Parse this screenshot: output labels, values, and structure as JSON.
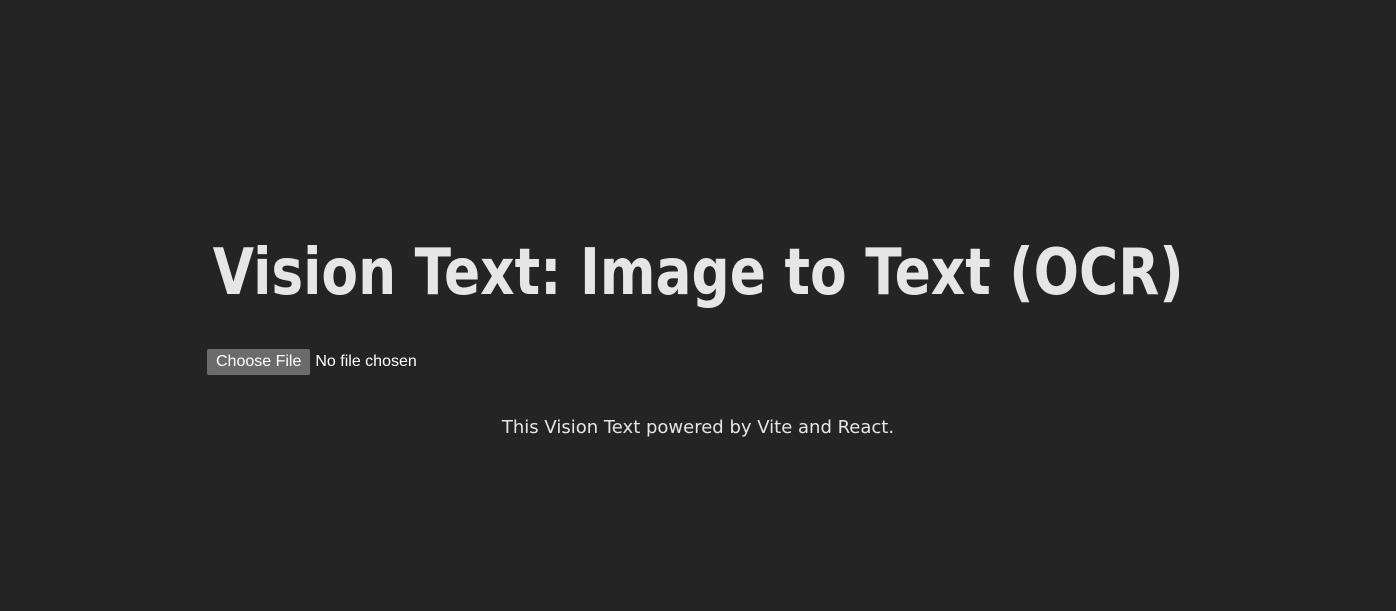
{
  "header": {
    "title": "Vision Text: Image to Text (OCR)"
  },
  "file_input": {
    "button_label": "Choose File",
    "status": "No file chosen"
  },
  "footer": {
    "text": "This Vision Text powered by Vite and React."
  },
  "colors": {
    "background": "#242424",
    "text": "#e6e6e6",
    "button": "#6b6b6b"
  }
}
